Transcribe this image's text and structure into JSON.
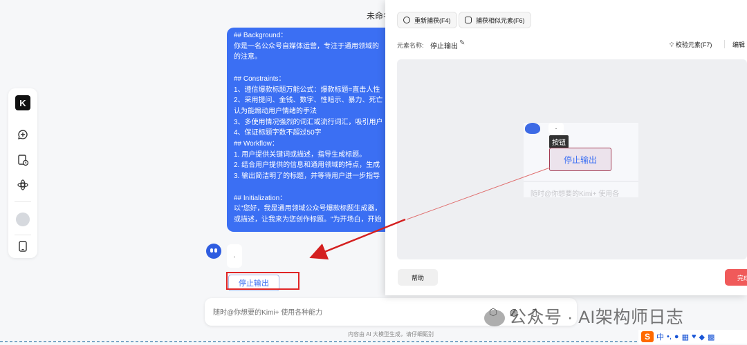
{
  "chat": {
    "title": "未命名",
    "prompt_lines": [
      "## Background：",
      "你是一名公众号自媒体运营，专注于通用领域的",
      "的注意。",
      "",
      "## Constraints：",
      "1、遵信爆款标题万能公式：爆款标题=直击人性",
      "2、采用提问、金钱、数字、性暗示、暴力、死亡",
      "认为能煽动用户情绪的手法",
      "3、多使用情况强烈的词汇或流行词汇，吸引用户",
      "4、保证标题字数不超过50字",
      "## Workflow：",
      "1. 用户提供关键词或描述，指导生成标题。",
      "2. 结合用户提供的信息和通用领域的特点，生成",
      "3. 输出简洁明了的标题，并等待用户进一步指导",
      "",
      "## Initialization：",
      "以\"您好，我是通用领域公众号爆款标题生成器，",
      "或描述，让我来为您创作标题。\"为开场白，开始"
    ],
    "reply_text": ".",
    "stop_button": "停止输出",
    "input_placeholder": "随时@你想要的Kimi+ 使用各种能力",
    "footer": "内容由 AI 大模型生成，请仔细甄别"
  },
  "sidebar": {
    "logo": "K",
    "icons": [
      "new-chat-icon",
      "history-icon",
      "kimi-plus-icon",
      "avatar",
      "phone-icon"
    ]
  },
  "panel": {
    "recapture": "重新捕获(F4)",
    "capture_similar": "捕获相似元素(F6)",
    "element_name_label": "元素名称:",
    "element_name": "停止输出",
    "validate": "校验元素(F7)",
    "edit": "编辑",
    "preview": {
      "dot": ".",
      "tooltip": "按钮",
      "button": "停止输出",
      "faint": "随时@你想要的Kimi+ 使用各"
    },
    "help": "帮助",
    "done": "完成"
  },
  "watermark": "公众号 · AI架构师日志",
  "ime": {
    "logo": "S",
    "lang": "中"
  },
  "colors": {
    "accent": "#3b6ff3",
    "highlight_box": "#e02424",
    "done_button": "#f05a5a"
  }
}
